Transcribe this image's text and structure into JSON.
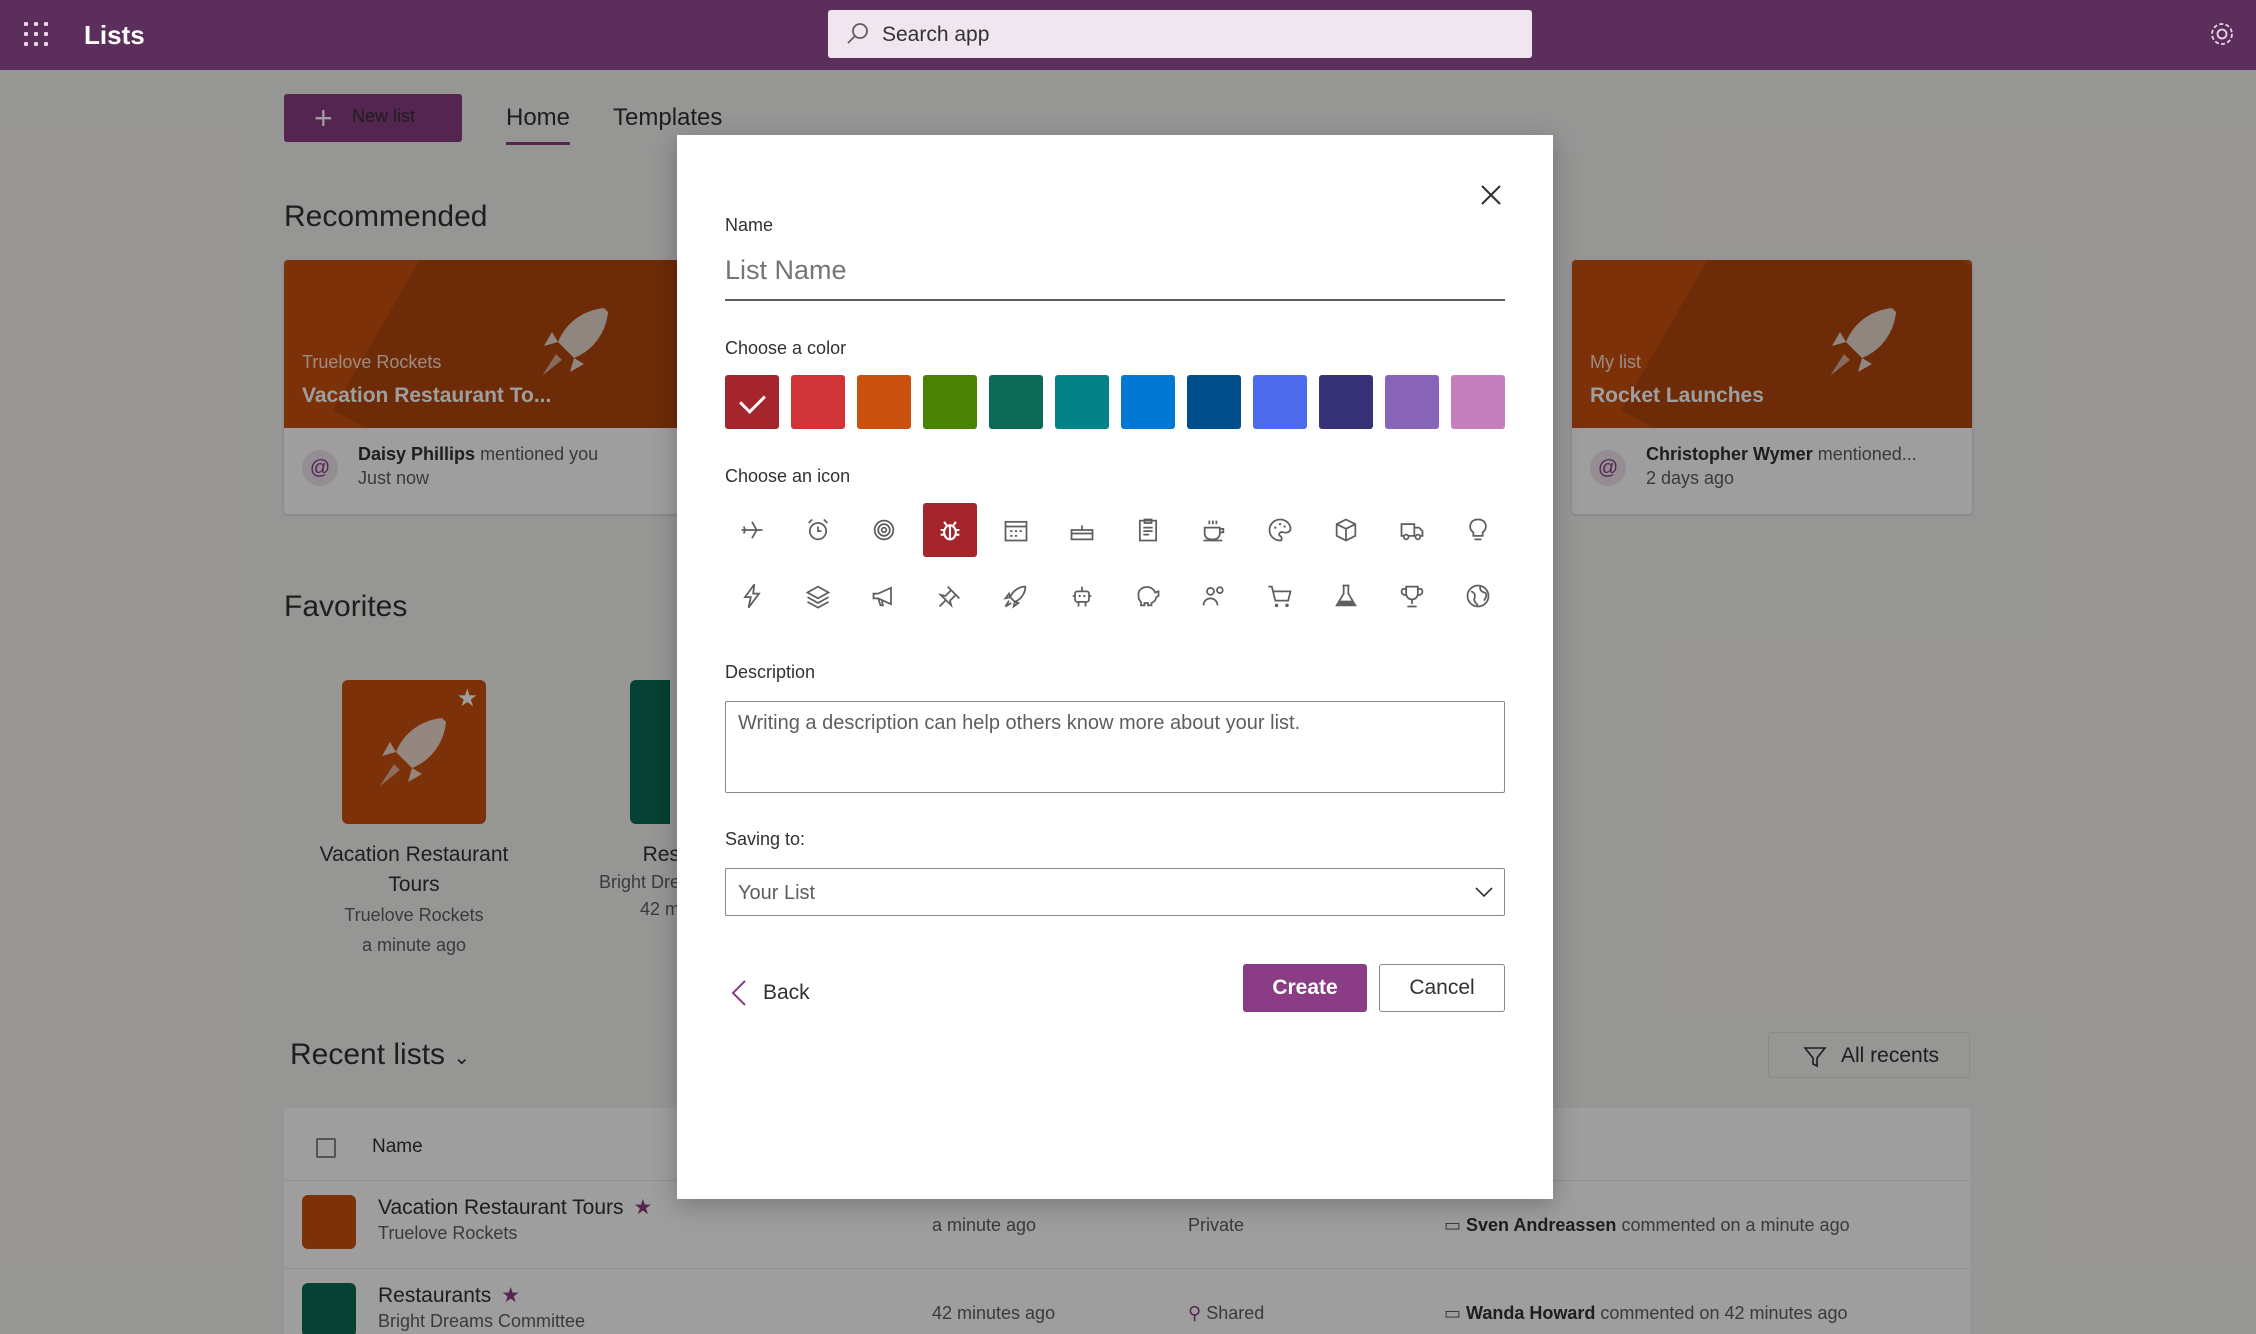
{
  "app": {
    "title": "Lists",
    "search_placeholder": "Search app"
  },
  "toolbar": {
    "new_list": "New list",
    "tabs": [
      "Home",
      "Templates"
    ]
  },
  "recommended": {
    "heading": "Recommended",
    "cards": [
      {
        "subtitle": "Truelove Rockets",
        "title": "Vacation Restaurant To...",
        "person": "Daisy Phillips",
        "action": "mentioned you",
        "when": "Just now"
      },
      {
        "subtitle": "My list",
        "title": "Rocket Launches",
        "person": "Christopher Wymer",
        "action": "mentioned...",
        "when": "2 days ago"
      }
    ]
  },
  "favorites": {
    "heading": "Favorites",
    "items": [
      {
        "name": "Vacation Restaurant Tours",
        "owner": "Truelove Rockets",
        "when": "a minute ago"
      },
      {
        "name": "Res",
        "owner": "Bright Dre",
        "when": "42 m"
      }
    ]
  },
  "recent": {
    "heading": "Recent lists",
    "filter": "All recents",
    "column_name": "Name",
    "rows": [
      {
        "name": "Vacation Restaurant Tours",
        "owner": "Truelove Rockets",
        "time": "a minute ago",
        "access": "Private",
        "person": "Sven Andreassen",
        "activity": "commented on a minute ago",
        "color": "#ca5010"
      },
      {
        "name": "Restaurants",
        "owner": "Bright Dreams Committee",
        "time": "42 minutes ago",
        "access": "Shared",
        "person": "Wanda Howard",
        "activity": "commented on 42 minutes ago",
        "color": "#0b6a53"
      }
    ]
  },
  "dialog": {
    "name_label": "Name",
    "name_placeholder": "List Name",
    "color_label": "Choose a color",
    "colors": [
      "#a4262c",
      "#d13438",
      "#ca5010",
      "#498205",
      "#0b6a53",
      "#038387",
      "#0078d4",
      "#004e8c",
      "#4f6bed",
      "#373277",
      "#8764b8",
      "#c47fbc"
    ],
    "selected_color": "#a4262c",
    "icon_label": "Choose an icon",
    "icons": [
      "airplane-icon",
      "alarm-clock-icon",
      "target-icon",
      "bug-icon",
      "calendar-icon",
      "cake-icon",
      "clipboard-icon",
      "coffee-icon",
      "palette-icon",
      "cube-icon",
      "truck-icon",
      "lightbulb-icon",
      "lightning-icon",
      "layers-icon",
      "megaphone-icon",
      "pin-icon",
      "rocket-icon",
      "robot-icon",
      "piggy-bank-icon",
      "people-icon",
      "cart-icon",
      "flask-icon",
      "trophy-icon",
      "globe-icon"
    ],
    "selected_icon": "bug-icon",
    "description_label": "Description",
    "description_placeholder": "Writing a description can help others know more about your list.",
    "saving_label": "Saving to:",
    "saving_value": "Your List",
    "back": "Back",
    "create": "Create",
    "cancel": "Cancel"
  }
}
